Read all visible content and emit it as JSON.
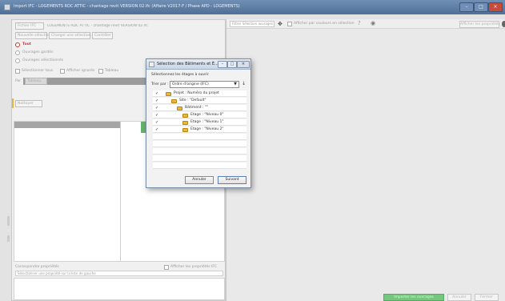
{
  "window": {
    "title": "Import IFC - LOGEMENTS RDC ATTIC - chantage revit VERSION 02.ifc (Affaire V2017-F / Phase APD - LOGEMENTS)",
    "minimize_glyph": "–",
    "maximize_glyph": "□",
    "close_glyph": "×"
  },
  "left_toolbar": {
    "file_button": "Fichier IFC",
    "file_path": "LOGEMENTS RDC ATTIC - chantage revit VERSION 02.ifc",
    "tabs": [
      "Nouvelle sélection",
      "Charger une sélection",
      "Contrôler"
    ]
  },
  "options": {
    "all_label": "Tout",
    "generic_label": "Ouvrages gardés",
    "selected_label": "Ouvrages sélectionnés",
    "chk_a_label": "Sélectionner tous",
    "chk_b_label": "Afficher ignorés",
    "chk_c_label": "Tableau",
    "filter_label": "Par",
    "filter_value": "Tableau",
    "section_tab": "Nettoyer"
  },
  "bottom_left": {
    "label": "Correspondre propriétés",
    "checkbox_label": "Afficher les propriétés IFC",
    "input_placeholder": "Sélectionner une propriété sur la liste de gauche"
  },
  "right_toolbar": {
    "filter_placeholder": "Filtrer Sélection ouvrages",
    "show_label": "Afficher par couleurs en sélection",
    "search_hint": "Afficher les propriétés"
  },
  "right_footer": {
    "import_btn": "Importer les ouvrages",
    "cancel_btn": "Annuler",
    "close_btn": "Fermer"
  },
  "dialog": {
    "title": "Sélection des Bâtiments et É...",
    "instruction": "Sélectionnez les étages à ouvrir",
    "sort_label": "Trier par :",
    "sort_value": "Ordre d'origine (IFC)",
    "tree": [
      {
        "label": "Projet : Numéro du projet",
        "level": 1
      },
      {
        "label": "Site : \"Default\"",
        "level": 2
      },
      {
        "label": "Bâtiment : \"\"",
        "level": 3
      },
      {
        "label": "Etage : \"Niveau 0\"",
        "level": 4
      },
      {
        "label": "Etage : \"Niveau 1\"",
        "level": 4
      },
      {
        "label": "Etage : \"Niveau 2\"",
        "level": 4
      }
    ],
    "cancel_label": "Annuler",
    "ok_label": "Suivant",
    "check_glyph": "✓"
  },
  "colors": {
    "title_bar": "#5a7aa2",
    "accent_red": "#c8392b",
    "folder": "#e8b73c",
    "green_button": "#74c77c"
  }
}
